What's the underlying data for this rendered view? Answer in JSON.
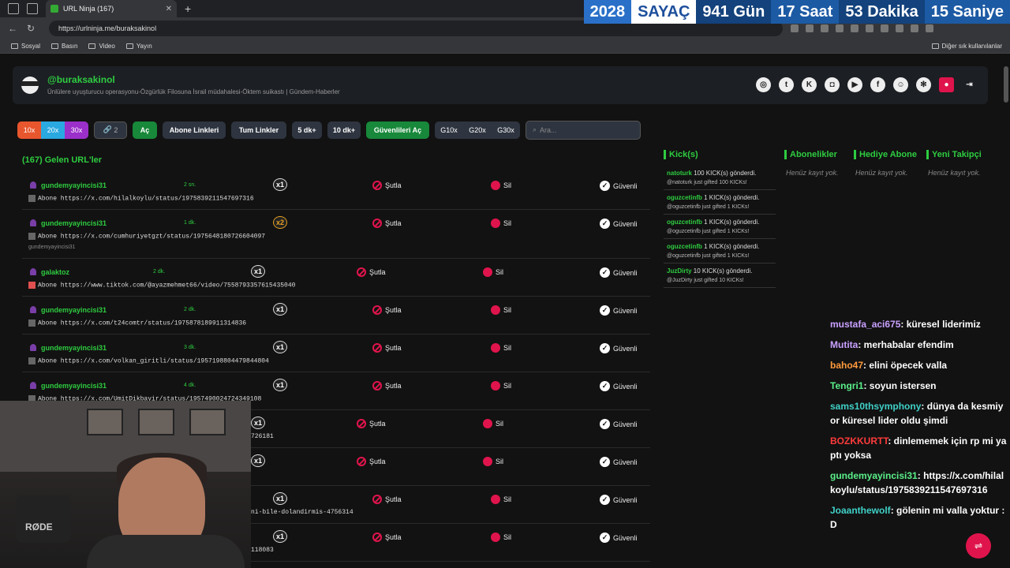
{
  "browser": {
    "tab_title": "URL Ninja (167)",
    "url": "https://urlninja.me/buraksakinol",
    "bookmarks": [
      "Sosyal",
      "Basın",
      "Video",
      "Yayın"
    ],
    "other_bookmarks": "Diğer sık kullanılanlar"
  },
  "counter": {
    "year": "2028",
    "label": "SAYAÇ",
    "days": "941 Gün",
    "hours": "17 Saat",
    "minutes": "53 Dakika",
    "seconds": "15 Saniye"
  },
  "profile": {
    "username": "@buraksakinol",
    "subtitle": "Ünlülere uyuşturucu operasyonu-Özgürlük Filosuna İsrail müdahalesi-Öktem suikastı | Gündem-Haberler"
  },
  "toolbar": {
    "m10": "10x",
    "m20": "20x",
    "m30": "30x",
    "link_count": "2",
    "open": "Aç",
    "subs": "Abone Linkleri",
    "all": "Tum Linkler",
    "five": "5 dk+",
    "ten": "10 dk+",
    "trusted": "Güvenlileri Aç",
    "g10": "G10x",
    "g20": "G20x",
    "g30": "G30x",
    "search_placeholder": "Ara..."
  },
  "list": {
    "title": "(167) Gelen URL'ler",
    "ban_label": "Şutla",
    "delete_label": "Sil",
    "safe_label": "Güvenli",
    "rows": [
      {
        "user": "gundemyayincisi31",
        "time": "2 sn.",
        "mult": "x1",
        "link": "Abone https://x.com/hilalkoylu/status/1975839211547697316",
        "extra": ""
      },
      {
        "user": "gundemyayincisi31",
        "time": "1 dk.",
        "mult": "x2",
        "link": "Abone https://x.com/cumhuriyetgzt/status/1975648180726604097",
        "extra": "gundemyayincisi31"
      },
      {
        "user": "galaktoz",
        "time": "2 dk.",
        "mult": "x1",
        "link": "Abone https://www.tiktok.com/@ayazmehmet66/video/7558793357615435040",
        "extra": ""
      },
      {
        "user": "gundemyayincisi31",
        "time": "2 dk.",
        "mult": "x1",
        "link": "Abone https://x.com/t24comtr/status/1975878189911314836",
        "extra": ""
      },
      {
        "user": "gundemyayincisi31",
        "time": "3 dk.",
        "mult": "x1",
        "link": "Abone https://x.com/volkan_giritli/status/1957198804479844804",
        "extra": ""
      },
      {
        "user": "gundemyayincisi31",
        "time": "4 dk.",
        "mult": "x1",
        "link": "Abone https://x.com/UmitDikbayir/status/1957490024724349108",
        "extra": ""
      },
      {
        "user": "",
        "time": "",
        "mult": "x1",
        "link": "726181",
        "extra": ""
      },
      {
        "user": "",
        "time": "",
        "mult": "x1",
        "link": "",
        "extra": ""
      },
      {
        "user": "",
        "time": "",
        "mult": "x1",
        "link": "ni-bile-dolandirmis-4756314",
        "extra": ""
      },
      {
        "user": "",
        "time": "",
        "mult": "x1",
        "link": "118083",
        "extra": ""
      }
    ]
  },
  "kicks": {
    "title": "Kick(s)",
    "items": [
      {
        "name": "natoturk",
        "text": "100 KICK(s) gönderdi.",
        "sub": "@natoturk just gifted 100 KICKs!"
      },
      {
        "name": "oguzcetinfb",
        "text": "1 KICK(s) gönderdi.",
        "sub": "@oguzcetinfb just gifted 1 KICKs!"
      },
      {
        "name": "oguzcetinfb",
        "text": "1 KICK(s) gönderdi.",
        "sub": "@oguzcetinfb just gifted 1 KICKs!"
      },
      {
        "name": "oguzcetinfb",
        "text": "1 KICK(s) gönderdi.",
        "sub": "@oguzcetinfb just gifted 1 KICKs!"
      },
      {
        "name": "JuzDirty",
        "text": "10 KICK(s) gönderdi.",
        "sub": "@JuzDirty just gifted 10 KICKs!"
      }
    ]
  },
  "columns": [
    {
      "title": "Abonelikler",
      "empty": "Henüz kayıt yok."
    },
    {
      "title": "Hediye Abone",
      "empty": "Henüz kayıt yok."
    },
    {
      "title": "Yeni Takipçi",
      "empty": "Henüz kayıt yok."
    }
  ],
  "chat": [
    {
      "user": "mustafa_aci675",
      "color": "#c9a0ff",
      "text": "küresel liderimiz"
    },
    {
      "user": "Mutita",
      "color": "#c9a0ff",
      "text": "merhabalar efendim"
    },
    {
      "user": "baho47",
      "color": "#ff9a3c",
      "text": "elini öpecek valla"
    },
    {
      "user": "Tengri1",
      "color": "#5af08a",
      "text": "soyun istersen"
    },
    {
      "user": "sams10thsymphony",
      "color": "#3fd1c8",
      "text": "dünya da kesmiyor küresel lider oldu şimdi"
    },
    {
      "user": "BOZKKURTT",
      "color": "#ff3b3b",
      "text": "dinlememek için rp mi yaptı yoksa"
    },
    {
      "user": "gundemyayincisi31",
      "color": "#5af08a",
      "text": "https://x.com/hilalkoylu/status/1975839211547697316"
    },
    {
      "user": "Joaanthewolf",
      "color": "#3fd1c8",
      "text": "gölenin mi valla yoktur :D"
    }
  ],
  "webcam_label": "RØDE",
  "colors": {
    "accent": "#2ecc40",
    "danger": "#e0144c"
  }
}
